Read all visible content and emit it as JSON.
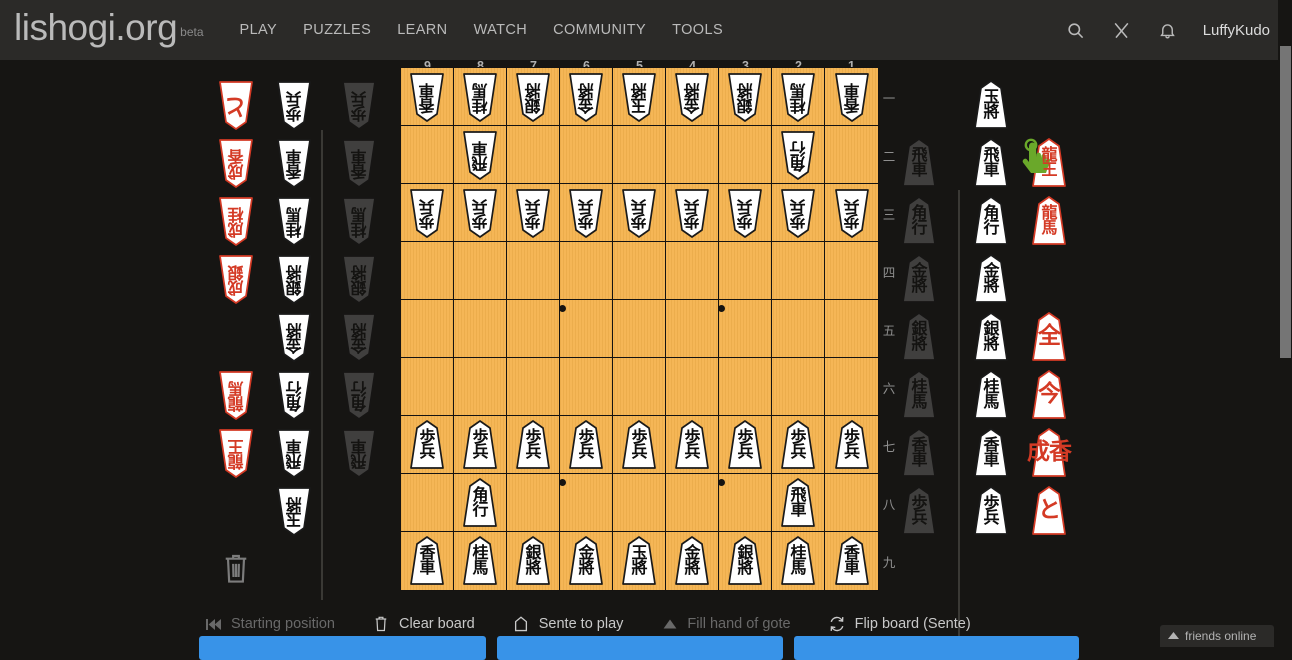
{
  "header": {
    "brand": "lishogi.org",
    "beta": "beta",
    "nav": [
      {
        "label": "PLAY"
      },
      {
        "label": "PUZZLES"
      },
      {
        "label": "LEARN"
      },
      {
        "label": "WATCH"
      },
      {
        "label": "COMMUNITY"
      },
      {
        "label": "TOOLS"
      }
    ],
    "icons": [
      {
        "name": "search-icon"
      },
      {
        "name": "challenge-swords-icon"
      },
      {
        "name": "notifications-bell-icon"
      }
    ],
    "username": "LuffyKudo"
  },
  "board": {
    "file_labels": [
      "9",
      "8",
      "7",
      "6",
      "5",
      "4",
      "3",
      "2",
      "1"
    ],
    "rank_labels": [
      "一",
      "二",
      "三",
      "四",
      "五",
      "六",
      "七",
      "八",
      "九"
    ],
    "colors": {
      "surface": "#f5b34f",
      "grid": "#151311",
      "background": "#161513"
    },
    "squares": [
      {
        "sq": "9a",
        "kanji": "香\n車",
        "side": "gote",
        "ink": "black"
      },
      {
        "sq": "8a",
        "kanji": "桂\n馬",
        "side": "gote",
        "ink": "black"
      },
      {
        "sq": "7a",
        "kanji": "銀\n將",
        "side": "gote",
        "ink": "black"
      },
      {
        "sq": "6a",
        "kanji": "金\n將",
        "side": "gote",
        "ink": "black"
      },
      {
        "sq": "5a",
        "kanji": "玉\n將",
        "side": "gote",
        "ink": "black"
      },
      {
        "sq": "4a",
        "kanji": "金\n將",
        "side": "gote",
        "ink": "black"
      },
      {
        "sq": "3a",
        "kanji": "銀\n將",
        "side": "gote",
        "ink": "black"
      },
      {
        "sq": "2a",
        "kanji": "桂\n馬",
        "side": "gote",
        "ink": "black"
      },
      {
        "sq": "1a",
        "kanji": "香\n車",
        "side": "gote",
        "ink": "black"
      },
      {
        "sq": "9b",
        "kanji": "",
        "side": "",
        "ink": ""
      },
      {
        "sq": "8b",
        "kanji": "飛\n車",
        "side": "gote",
        "ink": "black"
      },
      {
        "sq": "7b",
        "kanji": "",
        "side": "",
        "ink": ""
      },
      {
        "sq": "6b",
        "kanji": "",
        "side": "",
        "ink": ""
      },
      {
        "sq": "5b",
        "kanji": "",
        "side": "",
        "ink": ""
      },
      {
        "sq": "4b",
        "kanji": "",
        "side": "",
        "ink": ""
      },
      {
        "sq": "3b",
        "kanji": "",
        "side": "",
        "ink": ""
      },
      {
        "sq": "2b",
        "kanji": "角\n行",
        "side": "gote",
        "ink": "black"
      },
      {
        "sq": "1b",
        "kanji": "",
        "side": "",
        "ink": ""
      },
      {
        "sq": "9c",
        "kanji": "歩\n兵",
        "side": "gote",
        "ink": "black"
      },
      {
        "sq": "8c",
        "kanji": "歩\n兵",
        "side": "gote",
        "ink": "black"
      },
      {
        "sq": "7c",
        "kanji": "歩\n兵",
        "side": "gote",
        "ink": "black"
      },
      {
        "sq": "6c",
        "kanji": "歩\n兵",
        "side": "gote",
        "ink": "black"
      },
      {
        "sq": "5c",
        "kanji": "歩\n兵",
        "side": "gote",
        "ink": "black"
      },
      {
        "sq": "4c",
        "kanji": "歩\n兵",
        "side": "gote",
        "ink": "black"
      },
      {
        "sq": "3c",
        "kanji": "歩\n兵",
        "side": "gote",
        "ink": "black"
      },
      {
        "sq": "2c",
        "kanji": "歩\n兵",
        "side": "gote",
        "ink": "black"
      },
      {
        "sq": "1c",
        "kanji": "歩\n兵",
        "side": "gote",
        "ink": "black"
      },
      {
        "sq": "9d",
        "kanji": "",
        "side": "",
        "ink": ""
      },
      {
        "sq": "8d",
        "kanji": "",
        "side": "",
        "ink": ""
      },
      {
        "sq": "7d",
        "kanji": "",
        "side": "",
        "ink": ""
      },
      {
        "sq": "6d",
        "kanji": "",
        "side": "",
        "ink": ""
      },
      {
        "sq": "5d",
        "kanji": "",
        "side": "",
        "ink": ""
      },
      {
        "sq": "4d",
        "kanji": "",
        "side": "",
        "ink": ""
      },
      {
        "sq": "3d",
        "kanji": "",
        "side": "",
        "ink": ""
      },
      {
        "sq": "2d",
        "kanji": "",
        "side": "",
        "ink": ""
      },
      {
        "sq": "1d",
        "kanji": "",
        "side": "",
        "ink": ""
      },
      {
        "sq": "9e",
        "kanji": "",
        "side": "",
        "ink": ""
      },
      {
        "sq": "8e",
        "kanji": "",
        "side": "",
        "ink": ""
      },
      {
        "sq": "7e",
        "kanji": "",
        "side": "",
        "ink": ""
      },
      {
        "sq": "6e",
        "kanji": "",
        "side": "",
        "ink": ""
      },
      {
        "sq": "5e",
        "kanji": "",
        "side": "",
        "ink": ""
      },
      {
        "sq": "4e",
        "kanji": "",
        "side": "",
        "ink": ""
      },
      {
        "sq": "3e",
        "kanji": "",
        "side": "",
        "ink": ""
      },
      {
        "sq": "2e",
        "kanji": "",
        "side": "",
        "ink": ""
      },
      {
        "sq": "1e",
        "kanji": "",
        "side": "",
        "ink": ""
      },
      {
        "sq": "9f",
        "kanji": "",
        "side": "",
        "ink": ""
      },
      {
        "sq": "8f",
        "kanji": "",
        "side": "",
        "ink": ""
      },
      {
        "sq": "7f",
        "kanji": "",
        "side": "",
        "ink": ""
      },
      {
        "sq": "6f",
        "kanji": "",
        "side": "",
        "ink": ""
      },
      {
        "sq": "5f",
        "kanji": "",
        "side": "",
        "ink": ""
      },
      {
        "sq": "4f",
        "kanji": "",
        "side": "",
        "ink": ""
      },
      {
        "sq": "3f",
        "kanji": "",
        "side": "",
        "ink": ""
      },
      {
        "sq": "2f",
        "kanji": "",
        "side": "",
        "ink": ""
      },
      {
        "sq": "1f",
        "kanji": "",
        "side": "",
        "ink": ""
      },
      {
        "sq": "9g",
        "kanji": "歩\n兵",
        "side": "sente",
        "ink": "black"
      },
      {
        "sq": "8g",
        "kanji": "歩\n兵",
        "side": "sente",
        "ink": "black"
      },
      {
        "sq": "7g",
        "kanji": "歩\n兵",
        "side": "sente",
        "ink": "black"
      },
      {
        "sq": "6g",
        "kanji": "歩\n兵",
        "side": "sente",
        "ink": "black"
      },
      {
        "sq": "5g",
        "kanji": "歩\n兵",
        "side": "sente",
        "ink": "black"
      },
      {
        "sq": "4g",
        "kanji": "歩\n兵",
        "side": "sente",
        "ink": "black"
      },
      {
        "sq": "3g",
        "kanji": "歩\n兵",
        "side": "sente",
        "ink": "black"
      },
      {
        "sq": "2g",
        "kanji": "歩\n兵",
        "side": "sente",
        "ink": "black"
      },
      {
        "sq": "1g",
        "kanji": "歩\n兵",
        "side": "sente",
        "ink": "black"
      },
      {
        "sq": "9h",
        "kanji": "",
        "side": "",
        "ink": ""
      },
      {
        "sq": "8h",
        "kanji": "角\n行",
        "side": "sente",
        "ink": "black"
      },
      {
        "sq": "7h",
        "kanji": "",
        "side": "",
        "ink": ""
      },
      {
        "sq": "6h",
        "kanji": "",
        "side": "",
        "ink": ""
      },
      {
        "sq": "5h",
        "kanji": "",
        "side": "",
        "ink": ""
      },
      {
        "sq": "4h",
        "kanji": "",
        "side": "",
        "ink": ""
      },
      {
        "sq": "3h",
        "kanji": "",
        "side": "",
        "ink": ""
      },
      {
        "sq": "2h",
        "kanji": "飛\n車",
        "side": "sente",
        "ink": "black"
      },
      {
        "sq": "1h",
        "kanji": "",
        "side": "",
        "ink": ""
      },
      {
        "sq": "9i",
        "kanji": "香\n車",
        "side": "sente",
        "ink": "black"
      },
      {
        "sq": "8i",
        "kanji": "桂\n馬",
        "side": "sente",
        "ink": "black"
      },
      {
        "sq": "7i",
        "kanji": "銀\n將",
        "side": "sente",
        "ink": "black"
      },
      {
        "sq": "6i",
        "kanji": "金\n將",
        "side": "sente",
        "ink": "black"
      },
      {
        "sq": "5i",
        "kanji": "玉\n將",
        "side": "sente",
        "ink": "black"
      },
      {
        "sq": "4i",
        "kanji": "金\n將",
        "side": "sente",
        "ink": "black"
      },
      {
        "sq": "3i",
        "kanji": "銀\n將",
        "side": "sente",
        "ink": "black"
      },
      {
        "sq": "2i",
        "kanji": "桂\n馬",
        "side": "sente",
        "ink": "black"
      },
      {
        "sq": "1i",
        "kanji": "香\n車",
        "side": "sente",
        "ink": "black"
      }
    ]
  },
  "tray_gote": [
    {
      "promoted": "と",
      "pk_size": "sz1",
      "base": "歩\n兵",
      "bs_size": "sz2"
    },
    {
      "promoted": "成\n香",
      "pk_size": "sz2",
      "base": "香\n車",
      "bs_size": "sz2"
    },
    {
      "promoted": "成\n桂",
      "pk_size": "sz2",
      "base": "桂\n馬",
      "bs_size": "sz2"
    },
    {
      "promoted": "成\n銀",
      "pk_size": "sz2",
      "base": "銀\n將",
      "bs_size": "sz2"
    },
    {
      "promoted": "",
      "pk_size": "sz2",
      "base": "金\n將",
      "bs_size": "sz2"
    },
    {
      "promoted": "龍\n馬",
      "pk_size": "sz2",
      "base": "角\n行",
      "bs_size": "sz2"
    },
    {
      "promoted": "龍\n王",
      "pk_size": "sz2",
      "base": "飛\n車",
      "bs_size": "sz2"
    },
    {
      "promoted": "",
      "pk_size": "sz2",
      "base": "玉\n將",
      "bs_size": "sz2"
    }
  ],
  "tray_sente": [
    {
      "base": "玉\n將",
      "bs_size": "sz2",
      "promoted": "",
      "pk_size": "sz2"
    },
    {
      "base": "飛\n車",
      "bs_size": "sz2",
      "promoted": "龍\n王",
      "pk_size": "sz2"
    },
    {
      "base": "角\n行",
      "bs_size": "sz2",
      "promoted": "龍\n馬",
      "pk_size": "sz2"
    },
    {
      "base": "金\n將",
      "bs_size": "sz2",
      "promoted": "",
      "pk_size": "sz2"
    },
    {
      "base": "銀\n將",
      "bs_size": "sz2",
      "promoted": "全",
      "pk_size": "sz1"
    },
    {
      "base": "桂\n馬",
      "bs_size": "sz2",
      "promoted": "今",
      "pk_size": "sz1"
    },
    {
      "base": "香\n車",
      "bs_size": "sz2",
      "promoted": "成香",
      "pk_size": "sz1"
    },
    {
      "base": "歩\n兵",
      "bs_size": "sz2",
      "promoted": "と",
      "pk_size": "sz1"
    }
  ],
  "hand_gote": [
    "歩\n兵",
    "香\n車",
    "桂\n馬",
    "銀\n將",
    "金\n將",
    "角\n行",
    "飛\n車"
  ],
  "hand_sente": [
    "飛\n車",
    "角\n行",
    "金\n將",
    "銀\n將",
    "桂\n馬",
    "香\n車",
    "歩\n兵"
  ],
  "toolbar": [
    {
      "label": "Starting position",
      "icon": "rewind-icon",
      "disabled": true
    },
    {
      "label": "Clear board",
      "icon": "trash-icon",
      "disabled": false
    },
    {
      "label": "Sente to play",
      "icon": "pentagon-icon",
      "disabled": false
    },
    {
      "label": "Fill hand of gote",
      "icon": "triangle-up-icon",
      "disabled": true
    },
    {
      "label": "Flip board (Sente)",
      "icon": "flip-icon",
      "disabled": false
    }
  ],
  "trash_icon": {
    "name": "trash-can-icon"
  },
  "cursor_icon": {
    "name": "pointing-hand-cursor-icon",
    "color": "#6aa82a"
  },
  "friends": {
    "label": "friends online",
    "icon": "caret-up-icon"
  },
  "accent": {
    "blue": "#3893e8",
    "red": "#d43a25",
    "green": "#6aa82a"
  }
}
